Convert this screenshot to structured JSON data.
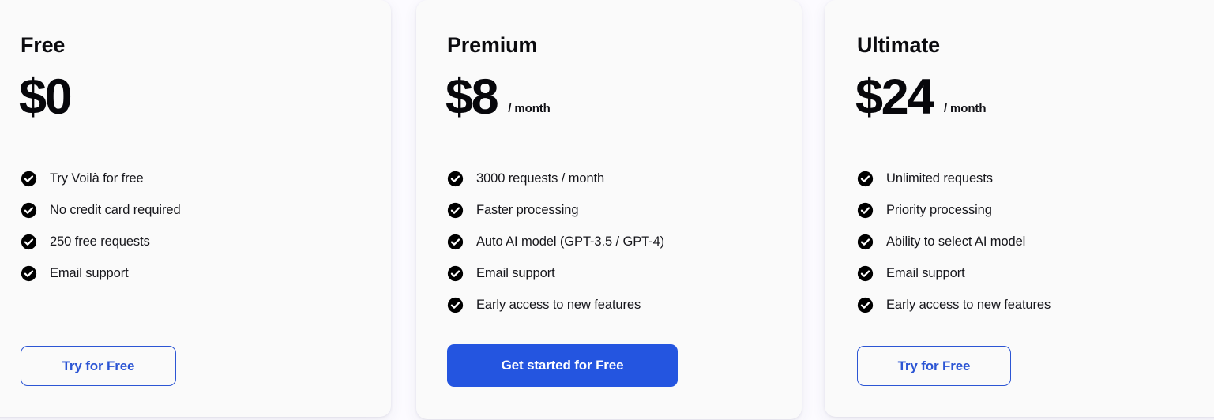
{
  "theme": {
    "page_background": "#fcfbff",
    "card_background": "#fafafa",
    "accent_blue": "#2455e0",
    "outline_blue": "#2c55d4",
    "check_color": "#000000",
    "text_color": "#16161b"
  },
  "plans": [
    {
      "id": "free",
      "name": "Free",
      "price": "$0",
      "period": "",
      "features": [
        "Try Voilà for free",
        "No credit card required",
        "250 free requests",
        "Email support"
      ],
      "cta": {
        "label": "Try for Free",
        "style": "outline"
      }
    },
    {
      "id": "premium",
      "name": "Premium",
      "price": "$8",
      "period": "/ month",
      "features": [
        "3000 requests / month",
        "Faster processing",
        "Auto AI model (GPT-3.5 / GPT-4)",
        "Email support",
        "Early access to new features"
      ],
      "cta": {
        "label": "Get started for Free",
        "style": "solid"
      }
    },
    {
      "id": "ultimate",
      "name": "Ultimate",
      "price": "$24",
      "period": "/ month",
      "features": [
        "Unlimited requests",
        "Priority processing",
        "Ability to select AI model",
        "Email support",
        "Early access to new features"
      ],
      "cta": {
        "label": "Try for Free",
        "style": "outline"
      }
    }
  ],
  "icons": {
    "check": "check-circle-filled-icon"
  }
}
